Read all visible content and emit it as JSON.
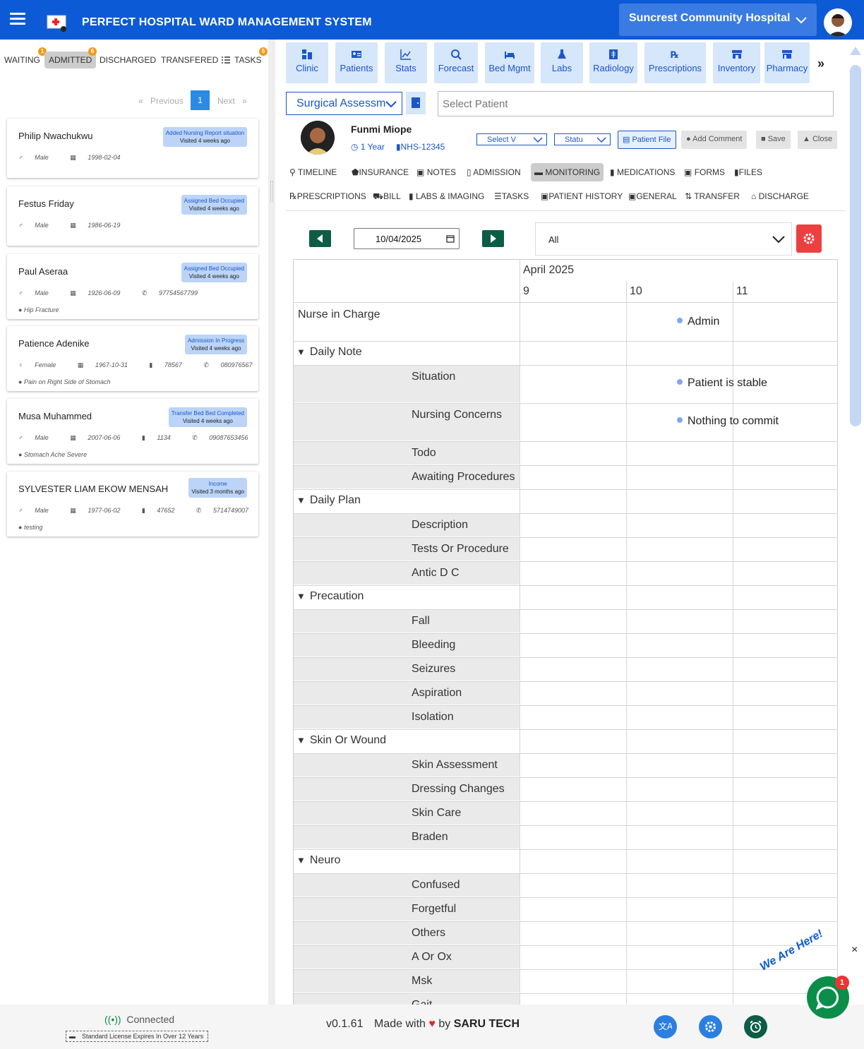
{
  "header": {
    "app_title": "PERFECT HOSPITAL WARD MANAGEMENT SYSTEM",
    "hospital": "Suncrest Community Hospital",
    "brand_color": "#0d5ad6"
  },
  "left_tabs": [
    {
      "label": "WAITING",
      "badge": "1"
    },
    {
      "label": "ADMITTED",
      "badge": "6",
      "active": true
    },
    {
      "label": "DISCHARGED"
    },
    {
      "label": "TRANSFERED"
    },
    {
      "label": "TASKS",
      "badge": "5"
    }
  ],
  "pager": {
    "previous": "Previous",
    "current": "1",
    "next": "Next",
    "prev_glyph": "«",
    "next_glyph": "»"
  },
  "patients": [
    {
      "name": "Philip Nwachukwu",
      "status": "Added Nursing Report situation",
      "visited": "Visited 4 weeks ago",
      "gender": "Male",
      "dob": "1998-02-04"
    },
    {
      "name": "Festus Friday",
      "status": "Assigned Bed Occupied",
      "visited": "Visited 4 weeks ago",
      "gender": "Male",
      "dob": "1986-06-19"
    },
    {
      "name": "Paul Aseraa",
      "status": "Assigned Bed Occupied",
      "visited": "Visited 4 weeks ago",
      "gender": "Male",
      "dob": "1926-06-09",
      "phone": "97754567799",
      "note": "Hip Fracture"
    },
    {
      "name": "Patience Adenike",
      "status": "Admission In Progress",
      "visited": "Visited 4 weeks ago",
      "gender": "Female",
      "dob": "1967-10-31",
      "id": "78567",
      "phone": "080976567",
      "note": "Pain on Right Side of Stomach"
    },
    {
      "name": "Musa Muhammed",
      "status": "Transfer Bed Bed Completed",
      "visited": "Visited 4 weeks ago",
      "gender": "Male",
      "dob": "2007-06-06",
      "id": "1134",
      "phone": "09087653456",
      "note": "Stomach Ache Severe"
    },
    {
      "name": "SYLVESTER LIAM EKOW MENSAH",
      "status": "Income",
      "visited": "Visited 3 months ago",
      "gender": "Male",
      "dob": "1977-06-02",
      "id": "47652",
      "phone": "5714749007",
      "note": "testing"
    }
  ],
  "modules": [
    "Clinic",
    "Patients",
    "Stats",
    "Forecast",
    "Bed Mgmt",
    "Labs",
    "Radiology",
    "Prescriptions",
    "Inventory",
    "Pharmacy"
  ],
  "more_glyph": "»",
  "form_select": "Surgical Assessment",
  "patient_select_placeholder": "Select Patient",
  "patient": {
    "name": "Funmi Miope",
    "age": "1 Year",
    "id": "NHS-12345"
  },
  "mini_selects": [
    "Select V",
    "Statu"
  ],
  "actions": {
    "file": "Patient File",
    "comment": "Add Comment",
    "save": "Save",
    "close": "Close"
  },
  "section_tabs_row1": [
    "TIMELINE",
    "INSURANCE",
    "NOTES",
    "ADMISSION",
    "MONITORING",
    "MEDICATIONS",
    "FORMS",
    "FILES"
  ],
  "section_tabs_row2": [
    "PRESCRIPTIONS",
    "BILL",
    "LABS & IMAGING",
    "TASKS",
    "PATIENT HISTORY",
    "GENERAL",
    "TRANSFER",
    "DISCHARGE"
  ],
  "date": "10/04/2025",
  "filter": "All",
  "calendar": {
    "month": "April 2025",
    "days": [
      "9",
      "10",
      "11"
    ],
    "nurse_in_charge": {
      "label": "Nurse in Charge",
      "value": "Admin"
    },
    "groups": [
      {
        "label": "Daily Note",
        "rows": [
          {
            "label": "Situation",
            "value": "Patient is stable"
          },
          {
            "label": "Nursing Concerns",
            "value": "Nothing to commit"
          },
          {
            "label": "Todo"
          },
          {
            "label": "Awaiting Procedures"
          }
        ]
      },
      {
        "label": "Daily Plan",
        "rows": [
          {
            "label": "Description"
          },
          {
            "label": "Tests Or Procedure"
          },
          {
            "label": "Antic D C"
          }
        ]
      },
      {
        "label": "Precaution",
        "rows": [
          {
            "label": "Fall"
          },
          {
            "label": "Bleeding"
          },
          {
            "label": "Seizures"
          },
          {
            "label": "Aspiration"
          },
          {
            "label": "Isolation"
          }
        ]
      },
      {
        "label": "Skin Or Wound",
        "rows": [
          {
            "label": "Skin Assessment"
          },
          {
            "label": "Dressing Changes"
          },
          {
            "label": "Skin Care"
          },
          {
            "label": "Braden"
          }
        ]
      },
      {
        "label": "Neuro",
        "rows": [
          {
            "label": "Confused"
          },
          {
            "label": "Forgetful"
          },
          {
            "label": "Others"
          },
          {
            "label": "A Or Ox"
          },
          {
            "label": "Msk"
          },
          {
            "label": "Gait"
          }
        ]
      }
    ]
  },
  "footer": {
    "connected": "Connected",
    "license": "Standard License Expires In Over 12 Years",
    "version": "v0.1.61",
    "made_with": "Made with",
    "by": "by",
    "company": "SARU TECH"
  },
  "chat": {
    "banner": "We Are Here!",
    "badge": "1",
    "close": "×"
  }
}
